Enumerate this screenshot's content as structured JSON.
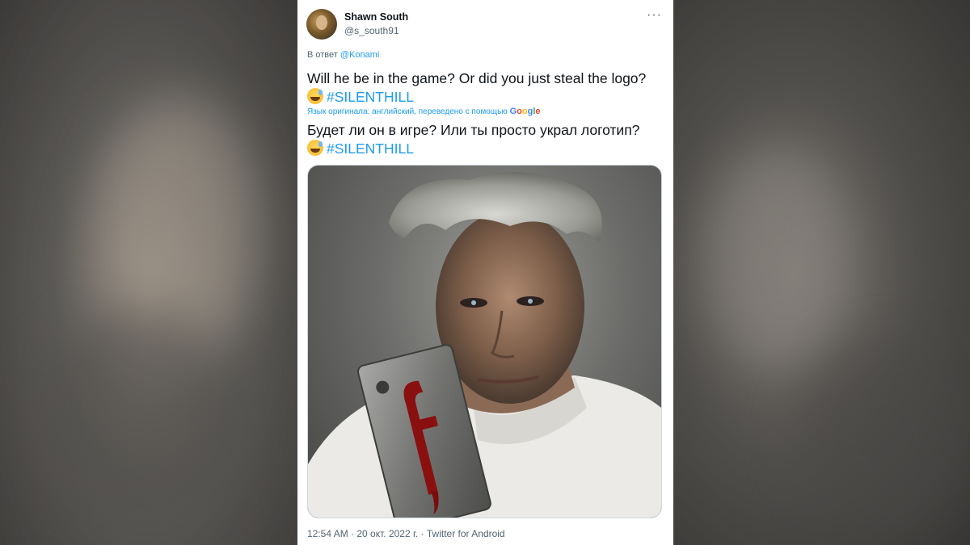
{
  "tweet": {
    "author_name": "Shawn South",
    "author_handle": "@s_south91",
    "reply_prefix": "В ответ",
    "reply_to": "@Konami",
    "text_original": "Will he be in the game? Or did you just steal the logo?",
    "hashtag": "#SILENTHILL",
    "translation_note": "Язык оригинала: английский, переведено с помощью",
    "translation_provider": "Google",
    "text_translated": "Будет ли он в игре? Или ты просто украл логотип?",
    "hashtag_translated": "#SILENTHILL",
    "timestamp": "12:54 AM · 20 окт. 2022 г. · Twitter for Android"
  },
  "icons": {
    "more": "more-icon",
    "emoji": "sweat-smile-emoji-icon"
  },
  "colors": {
    "link": "#1d9bf0",
    "text": "#0f1419",
    "muted": "#536471"
  }
}
